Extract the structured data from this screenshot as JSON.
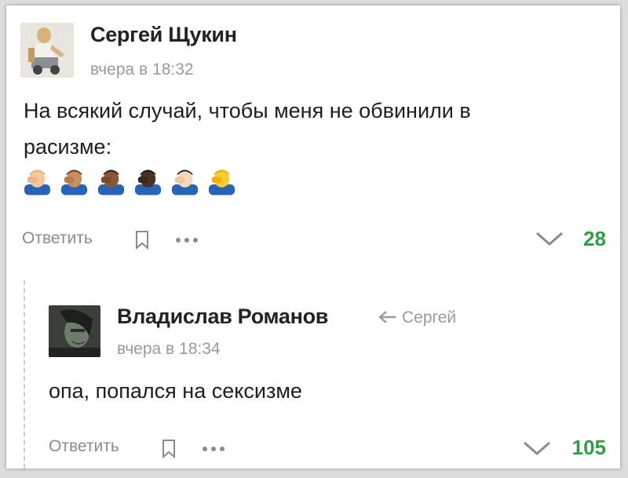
{
  "comment": {
    "author": "Сергей Щукин",
    "time": "вчера в 18:32",
    "text_line1": "На всякий случай, чтобы меня не обвинили в",
    "text_line2": "расизме:",
    "emojis": [
      "facepalm-light",
      "facepalm-medium",
      "facepalm-medium-dark",
      "facepalm-dark",
      "facepalm-default-light",
      "facepalm-yellow"
    ],
    "reply_label": "Ответить",
    "score": "28"
  },
  "reply": {
    "author": "Владислав Романов",
    "reply_to_name": "Сергей",
    "time": "вчера в 18:34",
    "text": "опа, попался на сексизме",
    "reply_label": "Ответить",
    "score": "105"
  },
  "colors": {
    "score": "#2e9d43",
    "muted": "#9a9a9a",
    "text": "#1e1e1e"
  }
}
